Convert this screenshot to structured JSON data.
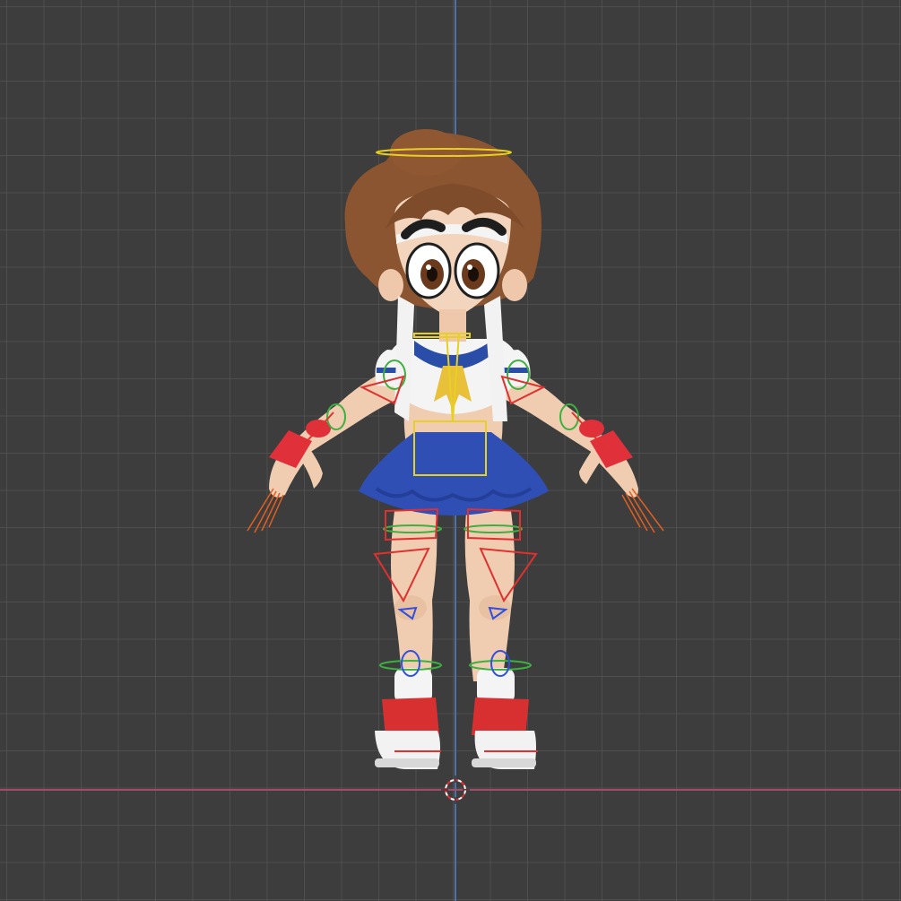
{
  "viewport": {
    "mode": "3d-viewport",
    "background_color": "#3d3d3d",
    "grid_color": "#5a5a5a",
    "axis_x_color": "#a0506a",
    "axis_y_color": "#4d78b8"
  },
  "character": {
    "skin_color": "#f0cdb0",
    "hair_color": "#8a5530",
    "shirt_color": "#f4f4f4",
    "collar_color": "#2a4da8",
    "skirt_color": "#2f4fb5",
    "glove_color": "#e0303a",
    "tie_color": "#e8c03a",
    "shoe_color": "#f0f0f0",
    "shoe_accent_color": "#d83030"
  },
  "rig": {
    "bone_red": "#e03030",
    "bone_green": "#3cb040",
    "bone_blue": "#3050e0",
    "bone_yellow": "#e8d020",
    "bone_orange": "#e06020"
  },
  "icons": {
    "cursor": "3d-cursor-icon"
  }
}
